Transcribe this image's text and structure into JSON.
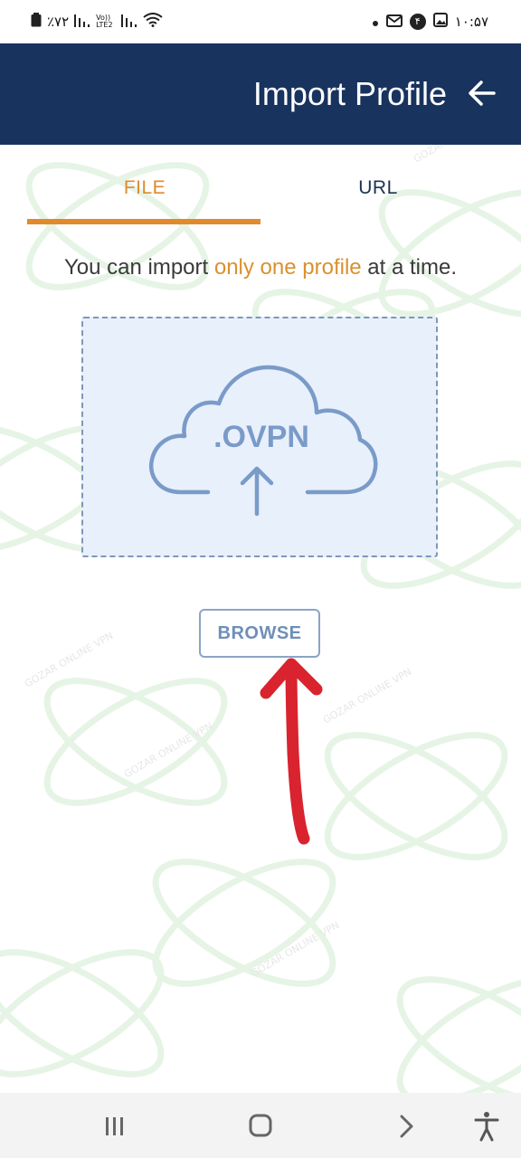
{
  "status_bar": {
    "battery": "٪۷۲",
    "network_label": "Vo)) LTE2",
    "time": "۱۰:۵۷",
    "notification_badge": "۴"
  },
  "app_bar": {
    "title": "Import Profile"
  },
  "tabs": [
    {
      "label": "FILE",
      "selected": true
    },
    {
      "label": "URL",
      "selected": false
    }
  ],
  "info": {
    "prefix": "You can import ",
    "highlight": "only one profile",
    "suffix": " at a time."
  },
  "dropzone": {
    "file_type": ".OVPN"
  },
  "browse_button": {
    "label": "BROWSE"
  },
  "watermark_text": "GOZAR ONLINE VPN",
  "colors": {
    "app_bar": "#18335e",
    "accent": "#e08a2c",
    "dropzone_bg": "#e8f0fc",
    "annotation_arrow": "#d9232e"
  },
  "nav_icons": [
    "recent-apps-icon",
    "home-icon",
    "back-icon",
    "accessibility-icon"
  ]
}
